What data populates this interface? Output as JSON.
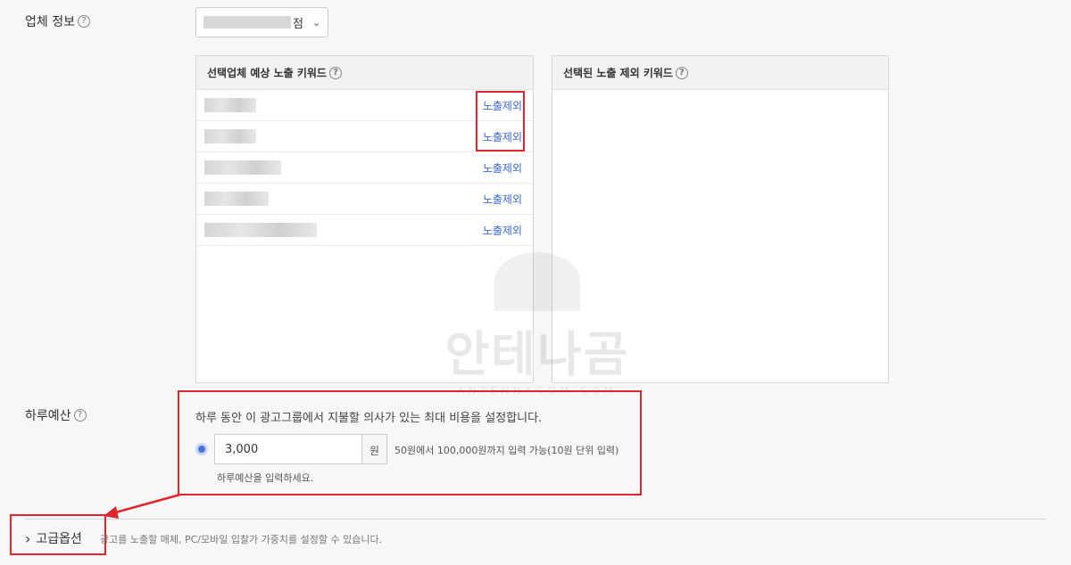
{
  "company": {
    "label": "업체 정보",
    "help": "?",
    "select_suffix": "점",
    "chevron": "⌄"
  },
  "selected_keywords_panel": {
    "title": "선택업체 예상 노출 키워드",
    "help": "?",
    "rows": [
      {
        "action": "노출제외"
      },
      {
        "action": "노출제외"
      },
      {
        "action": "노출제외"
      },
      {
        "action": "노출제외"
      },
      {
        "action": "노출제외"
      }
    ]
  },
  "excluded_keywords_panel": {
    "title": "선택된 노출 제외 키워드",
    "help": "?"
  },
  "budget": {
    "label": "하루예산",
    "help": "?",
    "description": "하루 동안 이 광고그룹에서 지불할 의사가 있는 최대 비용을 설정합니다.",
    "value": "3,000",
    "unit": "원",
    "range_hint": "50원에서 100,000원까지 입력 가능(10원 단위 입력)",
    "sub_hint": "하루예산을 입력하세요."
  },
  "advanced": {
    "chevron": "›",
    "label": "고급옵션",
    "description": "광고를 노출할 매체, PC/모바일 입찰가 가중치를 설정할 수 있습니다."
  },
  "watermark": {
    "text": "안테나곰",
    "sub": "ANTENNAGOM.COM"
  },
  "colors": {
    "highlight": "#e0252c",
    "link": "#3b6ad0",
    "radio": "#4a72d9"
  }
}
